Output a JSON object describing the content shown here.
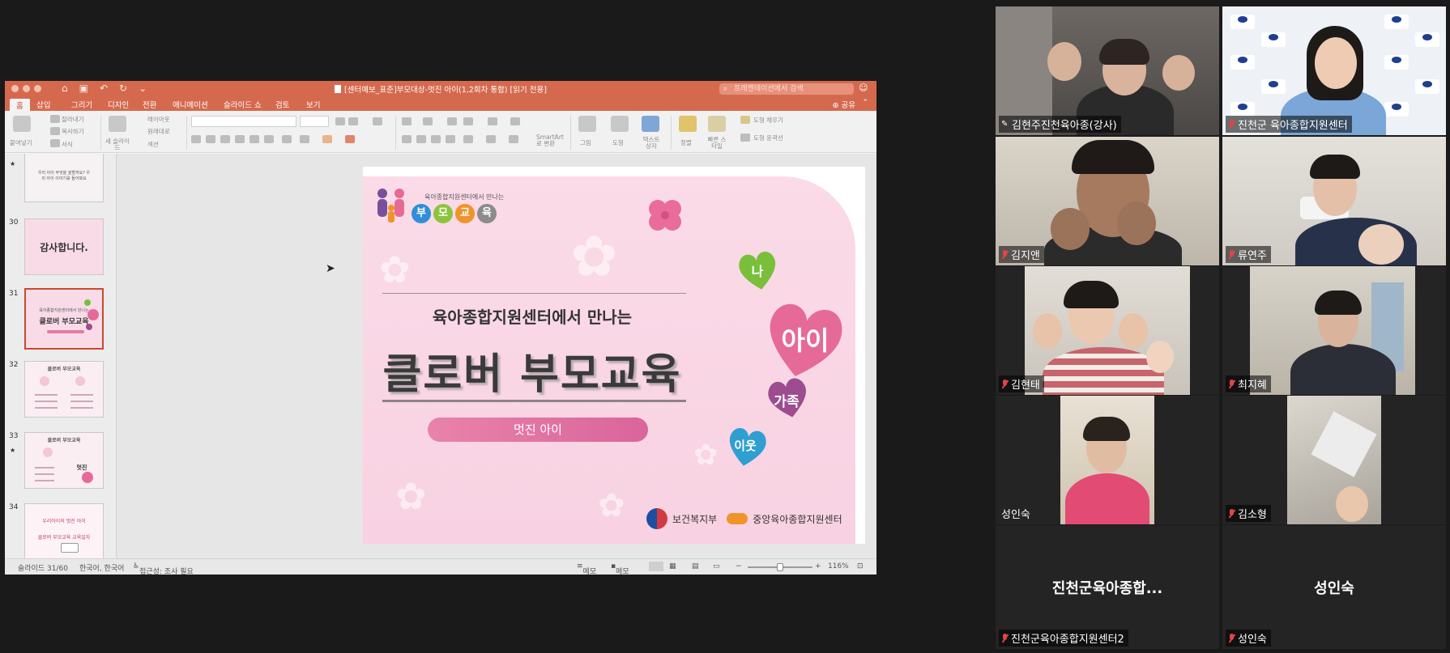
{
  "ppt": {
    "window_title": "[센터예보_표준]부모대상-멋진 아이(1,2회차 통합) [읽기 전용]",
    "search_placeholder": "프레젠테이션에서 검색",
    "tabs": [
      "홈",
      "삽입",
      "그리기",
      "디자인",
      "전환",
      "애니메이션",
      "슬라이드 쇼",
      "검토",
      "보기"
    ],
    "share_label": "공유",
    "ribbon": {
      "paste": "붙여넣기",
      "cut": "잘라내기",
      "copy": "복사하기",
      "format": "서식",
      "new_slide": "새 슬라이드",
      "layout": "레이아웃",
      "reset": "원래대로",
      "section": "섹션",
      "smartart": "SmartArt로 변환",
      "picture": "그림",
      "shape": "도형",
      "textbox": "텍스트 상자",
      "arrange": "정렬",
      "quick_styles": "빠른 스타일",
      "shape_fill": "도형 채우기",
      "shape_outline": "도형 윤곽선"
    },
    "thumbnails": [
      {
        "num": "29",
        "star": "★",
        "text": "우리 아이 무엇을 잘할까요? 우리 아이 이야기를 들어봐요",
        "sub": ""
      },
      {
        "num": "30",
        "star": "",
        "text": "감사합니다.",
        "sub": ""
      },
      {
        "num": "31",
        "star": "",
        "text": "클로버 부모교육",
        "sub": "육아종합지원센터에서 만나는"
      },
      {
        "num": "32",
        "star": "",
        "text": "클로버 부모교육",
        "sub": ""
      },
      {
        "num": "33",
        "star": "★",
        "text": "클로버 부모교육",
        "sub": "멋진"
      },
      {
        "num": "34",
        "star": "",
        "text": "우리아이의 멋진 아이",
        "sub": "클로버 부모교육 교육일자"
      }
    ],
    "selected_thumbnail": 3,
    "slide": {
      "header_sub": "육아종합지원센터에서 만나는",
      "header_chars": [
        "부",
        "모",
        "교",
        "육"
      ],
      "header_colors": [
        "#2f8fd8",
        "#8cc43c",
        "#f0932b",
        "#8b8b8b"
      ],
      "subtitle": "육아종합지원센터에서 만나는",
      "title": "클로버 부모교육",
      "pill": "멋진 아이",
      "hearts": [
        {
          "label": "나",
          "color": "#79bf3a"
        },
        {
          "label": "아이",
          "color": "#e66a98"
        },
        {
          "label": "가족",
          "color": "#9d4c8f"
        },
        {
          "label": "이웃",
          "color": "#2e9fd0"
        }
      ],
      "footer_left": "보건복지부",
      "footer_right": "중앙육아종합지원센터"
    },
    "status": {
      "slide_pos": "슬라이드 31/60",
      "lang": "한국어, 한국어",
      "accessibility": "접근성: 조사 필요",
      "notes": "메모",
      "comments": "메모",
      "zoom": "116%"
    }
  },
  "zoom": {
    "tiles": [
      {
        "name": "김현주진천육아종(강사)",
        "icon": "pin-icon",
        "active": true,
        "bg": "#5e5a57",
        "skin": "#d9b39b",
        "shirt": "#2a2a2a"
      },
      {
        "name": "진천군 육아종합지원센터",
        "icon": "mic-muted-icon",
        "active": false,
        "bg": "#e9eef5",
        "skin": "#f0cbb4",
        "shirt": "#7aa6d8"
      },
      {
        "name": "김지앤",
        "icon": "mic-muted-icon",
        "active": false,
        "bg": "#cfc9be",
        "skin": "#a57a5f",
        "shirt": "#2b2b2b"
      },
      {
        "name": "류연주",
        "icon": "mic-muted-icon",
        "active": false,
        "bg": "#dedbd5",
        "skin": "#e3c0a7",
        "shirt": "#27324a"
      },
      {
        "name": "김현태",
        "icon": "mic-muted-icon",
        "active": false,
        "bg": "#d8d3cb",
        "skin": "#edc8b0",
        "shirt": "#c8646b"
      },
      {
        "name": "최지혜",
        "icon": "mic-muted-icon",
        "active": false,
        "bg": "#cbc6bc",
        "skin": "#d9b39c",
        "shirt": "#2b2e36"
      },
      {
        "name": "성인숙",
        "icon": "",
        "active": false,
        "bg": "#e0d5c4",
        "skin": "#e0bca2",
        "shirt": "#e24b74"
      },
      {
        "name": "김소형",
        "icon": "mic-muted-icon",
        "active": false,
        "bg": "#c9c5bd",
        "skin": "#e8c7ad",
        "shirt": "#ececec"
      },
      {
        "name": "진천군육아종합지원센터2",
        "center": "진천군육아종합...",
        "icon": "mic-muted-icon",
        "active": false
      },
      {
        "name": "성인숙",
        "center": "성인숙",
        "icon": "mic-muted-icon",
        "active": false
      }
    ]
  }
}
